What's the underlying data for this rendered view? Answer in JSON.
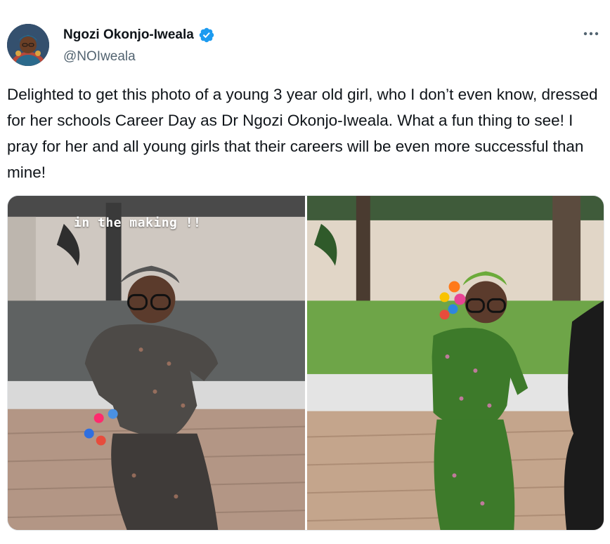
{
  "author": {
    "display_name": "Ngozi Okonjo-Iweala",
    "handle": "@NOIweala",
    "verified_icon": "verified-badge-icon",
    "verified_color": "#1d9bf0"
  },
  "tweet": {
    "text": "Delighted to get this photo of a young 3 year old girl, who I don’t even know, dressed for her schools Career Day as Dr Ngozi Okonjo-Iweala. What a fun thing to see! I pray for her and all young girls that their careers will be even more successful than mine!"
  },
  "media": {
    "photos": [
      {
        "caption": "in the making !!",
        "tone": "grayscale"
      },
      {
        "caption": "",
        "tone": "color"
      }
    ]
  },
  "colors": {
    "text_primary": "#0f1419",
    "text_secondary": "#536471",
    "accent": "#1d9bf0"
  }
}
